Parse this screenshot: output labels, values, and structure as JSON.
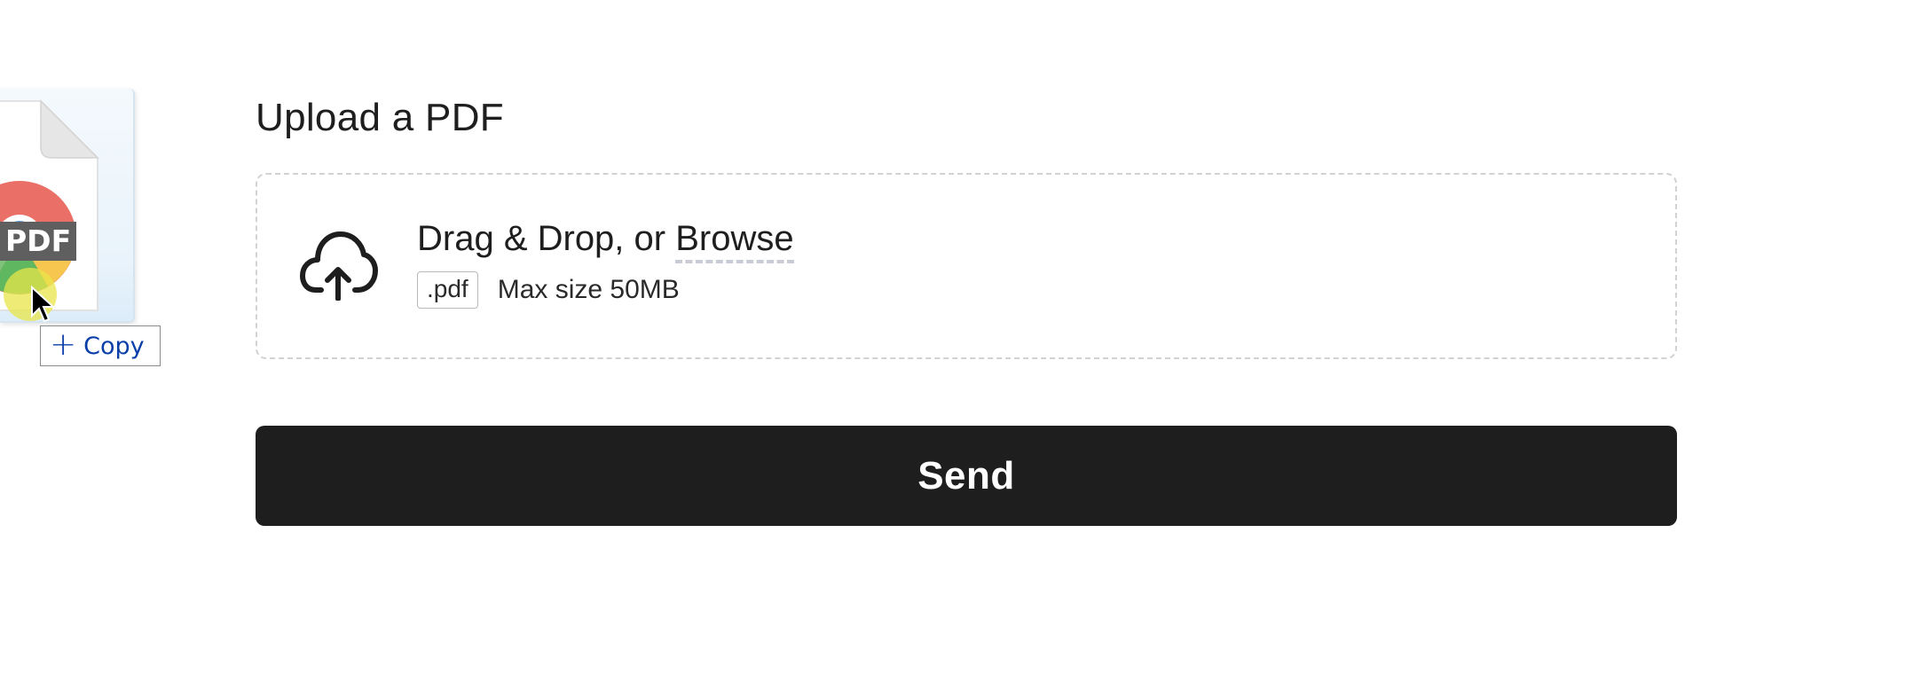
{
  "drag": {
    "file_icon_label": "PDF",
    "tooltip_label": "Copy",
    "tooltip_color": "#0b3fa8"
  },
  "form": {
    "title": "Upload a PDF",
    "dropzone": {
      "prompt": "Drag & Drop, or ",
      "browse_label": "Browse",
      "file_type": ".pdf",
      "max_size": "Max size 50MB",
      "icon": "cloud-upload-icon"
    },
    "send_label": "Send",
    "button_color": "#1e1e1e"
  }
}
